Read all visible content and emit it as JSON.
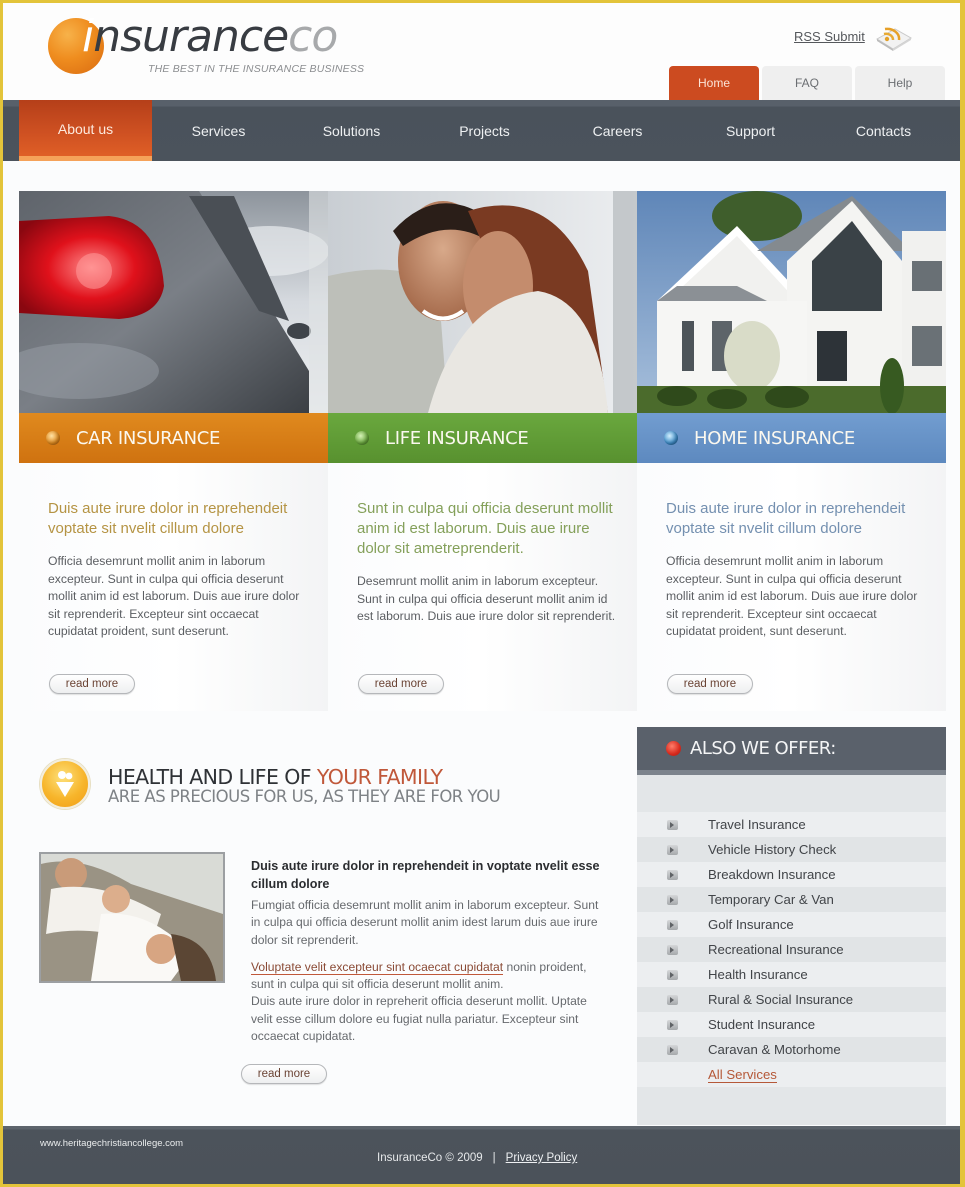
{
  "header": {
    "logo": {
      "i": "i",
      "main": "nsurance",
      "suffix": "co",
      "tagline": "THE BEST IN THE INSURANCE BUSINESS"
    },
    "rss_label": "RSS Submit",
    "top_tabs": [
      {
        "label": "Home",
        "active": true
      },
      {
        "label": "FAQ",
        "active": false
      },
      {
        "label": "Help",
        "active": false
      }
    ]
  },
  "nav": {
    "items": [
      {
        "label": "About us",
        "active": true
      },
      {
        "label": "Services"
      },
      {
        "label": "Solutions"
      },
      {
        "label": "Projects"
      },
      {
        "label": "Careers"
      },
      {
        "label": "Support"
      },
      {
        "label": "Contacts"
      }
    ]
  },
  "features": [
    {
      "title": "CAR INSURANCE",
      "color": "#d2780f",
      "lead_color": "#b08a3a",
      "lead": "Duis aute irure dolor in reprehendeit voptate sit nvelit cillum dolore",
      "text": "Officia desemrunt mollit anim in laborum excepteur. Sunt in culpa qui officia deserunt mollit anim id est laborum. Duis aue irure dolor sit reprenderit. Excepteur sint occaecat cupidatat proident, sunt deserunt.",
      "button": "read more",
      "icon": "orange-bullet-icon"
    },
    {
      "title": "LIFE INSURANCE",
      "color": "#5e9a35",
      "lead_color": "#7e9c53",
      "lead": "Sunt in culpa qui officia deserunt mollit anim id est laborum. Duis aue irure dolor sit ametreprenderit.",
      "text": "Desemrunt mollit anim in laborum excepteur. Sunt in culpa qui officia deserunt mollit anim id est laborum. Duis aue irure dolor sit reprenderit.",
      "button": "read more",
      "icon": "green-bullet-icon"
    },
    {
      "title": "HOME INSURANCE",
      "color": "#6591c5",
      "lead_color": "#6f8db0",
      "lead": "Duis aute irure dolor in reprehendeit voptate sit nvelit cillum dolore",
      "text": "Officia desemrunt mollit anim in laborum excepteur. Sunt in culpa qui officia deserunt mollit anim id est laborum. Duis aue irure dolor sit reprenderit. Excepteur sint occaecat cupidatat proident, sunt deserunt.",
      "button": "read more",
      "icon": "blue-bullet-icon"
    }
  ],
  "health": {
    "title_main": "HEALTH AND LIFE OF ",
    "title_accent": "YOUR FAMILY",
    "subtitle": "ARE AS PRECIOUS FOR US, AS THEY ARE FOR YOU",
    "article": {
      "heading": "Duis aute irure dolor in reprehendeit in voptate nvelit esse cillum dolore",
      "para1": "Fumgiat officia desemrunt mollit anim in laborum excepteur. Sunt in culpa qui officia deserunt mollit anim idest larum duis aue irure dolor sit reprenderit.",
      "link": "Voluptate velit excepteur sint ocaecat cupidatat",
      "para2_rest": " nonin proident, sunt in culpa qui sit officia deserunt mollit anim.",
      "para3": "Duis aute irure dolor in repreherit officia deserunt mollit. Uptate velit esse cillum dolore eu fugiat nulla pariatur. Excepteur sint occaecat cupidatat.",
      "button": "read more"
    }
  },
  "offers": {
    "title": "ALSO WE OFFER:",
    "items": [
      "Travel Insurance",
      "Vehicle History Check",
      "Breakdown Insurance",
      "Temporary Car & Van",
      "Golf Insurance",
      "Recreational Insurance",
      "Health Insurance",
      "Rural & Social Insurance",
      "Student Insurance",
      "Caravan & Motorhome"
    ],
    "all_link": "All Services"
  },
  "footer": {
    "url": "www.heritagechristiancollege.com",
    "copyright": "InsuranceCo © 2009",
    "separator": "|",
    "privacy": "Privacy Policy"
  }
}
